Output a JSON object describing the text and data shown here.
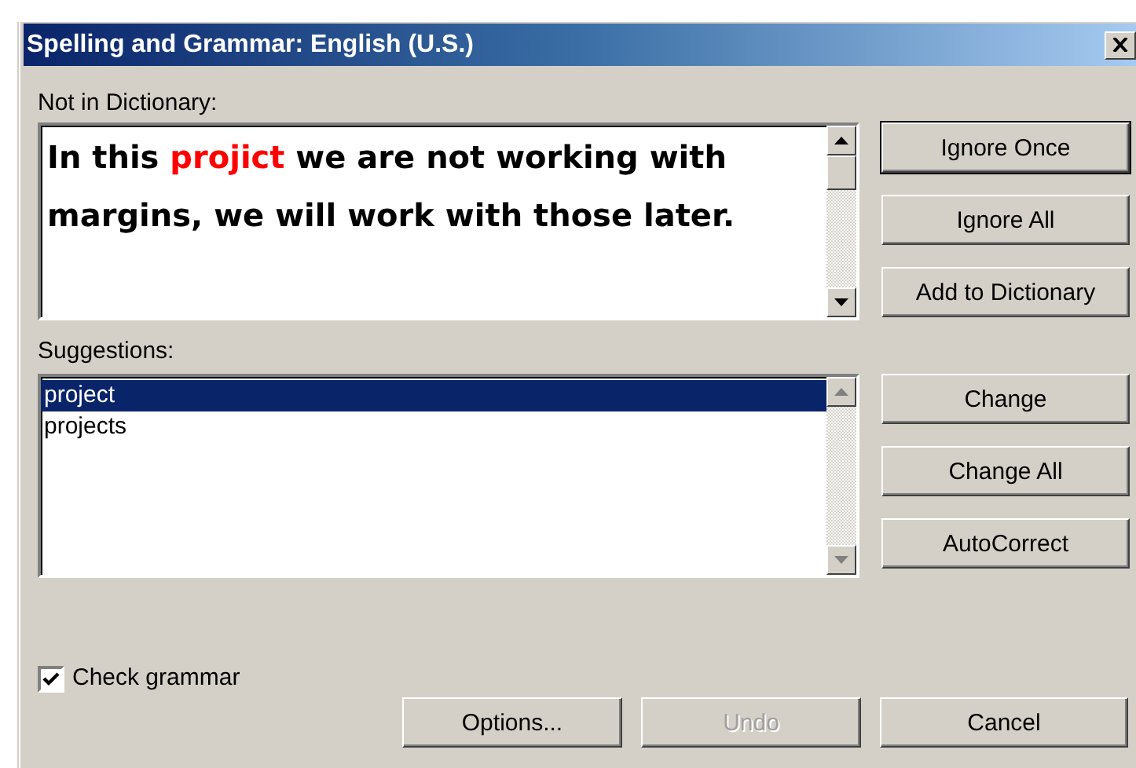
{
  "window": {
    "title": "Spelling and Grammar: English (U.S.)"
  },
  "not_in_dictionary": {
    "label": "Not in Dictionary:",
    "segments": [
      {
        "kind": "plain",
        "text": "In this "
      },
      {
        "kind": "error",
        "text": "projict"
      },
      {
        "kind": "plain",
        "text": " we are not working with margins, we will work with those later."
      }
    ]
  },
  "side_buttons_top": [
    {
      "label": "Ignore Once",
      "disabled": false,
      "default": true
    },
    {
      "label": "Ignore All",
      "disabled": false,
      "default": false
    },
    {
      "label": "Add to Dictionary",
      "disabled": false,
      "default": false
    }
  ],
  "suggestions": {
    "label": "Suggestions:",
    "items": [
      {
        "text": "project",
        "selected": true
      },
      {
        "text": "projects",
        "selected": false
      }
    ]
  },
  "side_buttons_bottom": [
    {
      "label": "Change",
      "disabled": false,
      "default": false
    },
    {
      "label": "Change All",
      "disabled": false,
      "default": false
    },
    {
      "label": "AutoCorrect",
      "disabled": false,
      "default": false
    }
  ],
  "check_grammar": {
    "label": "Check grammar",
    "checked": true
  },
  "bottom_buttons": [
    {
      "label": "Options...",
      "disabled": false,
      "default": false
    },
    {
      "label": "Undo",
      "disabled": true,
      "default": false
    },
    {
      "label": "Cancel",
      "disabled": false,
      "default": false
    }
  ]
}
